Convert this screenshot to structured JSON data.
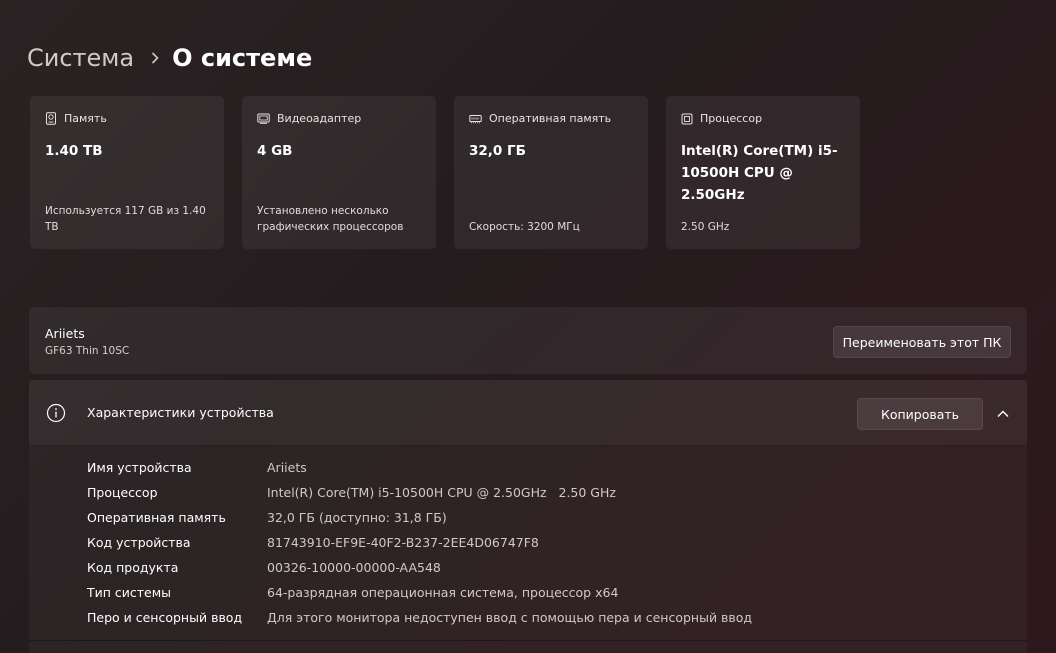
{
  "breadcrumb": {
    "parent": "Система",
    "current": "О системе"
  },
  "cards": [
    {
      "icon": "storage-icon",
      "title": "Память",
      "value": "1.40 TB",
      "footer": "Используется 117 GB из 1.40 TB"
    },
    {
      "icon": "display-adapter-icon",
      "title": "Видеоадаптер",
      "value": "4 GB",
      "footer": "Установлено несколько графических процессоров"
    },
    {
      "icon": "ram-icon",
      "title": "Оперативная память",
      "value": "32,0 ГБ",
      "footer": "Скорость: 3200 МГц"
    },
    {
      "icon": "processor-icon",
      "title": "Процессор",
      "value": "Intel(R) Core(TM) i5-10500H CPU @ 2.50GHz",
      "footer": "2.50 GHz"
    }
  ],
  "pc": {
    "name": "Ariiets",
    "model": "GF63 Thin 10SC",
    "rename_label": "Переименовать этот ПК"
  },
  "specs": {
    "title": "Характеристики устройства",
    "copy_label": "Копировать",
    "rows": [
      {
        "label": "Имя устройства",
        "value": "Ariiets"
      },
      {
        "label": "Процессор",
        "value": "Intel(R) Core(TM) i5-10500H CPU @ 2.50GHz   2.50 GHz"
      },
      {
        "label": "Оперативная память",
        "value": "32,0 ГБ (доступно: 31,8 ГБ)"
      },
      {
        "label": "Код устройства",
        "value": "81743910-EF9E-40F2-B237-2EE4D06747F8"
      },
      {
        "label": "Код продукта",
        "value": "00326-10000-00000-AA548"
      },
      {
        "label": "Тип системы",
        "value": "64-разрядная операционная система, процессор x64"
      },
      {
        "label": "Перо и сенсорный ввод",
        "value": "Для этого монитора недоступен ввод с помощью пера и сенсорный ввод"
      }
    ]
  }
}
